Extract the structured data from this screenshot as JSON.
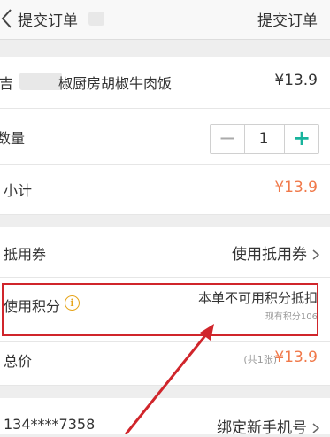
{
  "header": {
    "title": "提交订单",
    "right_title": "提交订单"
  },
  "item": {
    "name": "吉",
    "name_rest": "椒厨房胡椒牛肉饭",
    "price": "¥13.9"
  },
  "quantity": {
    "label": "数量",
    "minus": "−",
    "value": "1",
    "plus": "+"
  },
  "subtotal": {
    "label": "小计",
    "value": "¥13.9"
  },
  "voucher": {
    "label": "抵用券",
    "value": "使用抵用券"
  },
  "points": {
    "label": "使用积分",
    "info": "i",
    "unavailable": "本单不可用积分抵扣",
    "current": "现有积分106"
  },
  "total": {
    "label": "总价",
    "count": "(共1张)",
    "value": "¥13.9"
  },
  "phone": {
    "number": "134****7358",
    "action": "绑定新手机号"
  },
  "colors": {
    "accent": "#18b39c",
    "price": "#f0794a",
    "annotation": "#d0252b"
  },
  "icons": {
    "back": "chevron-left-icon",
    "chevron": "chevron-right-icon",
    "info": "info-circle-icon",
    "annotation": "red-arrow-icon"
  }
}
